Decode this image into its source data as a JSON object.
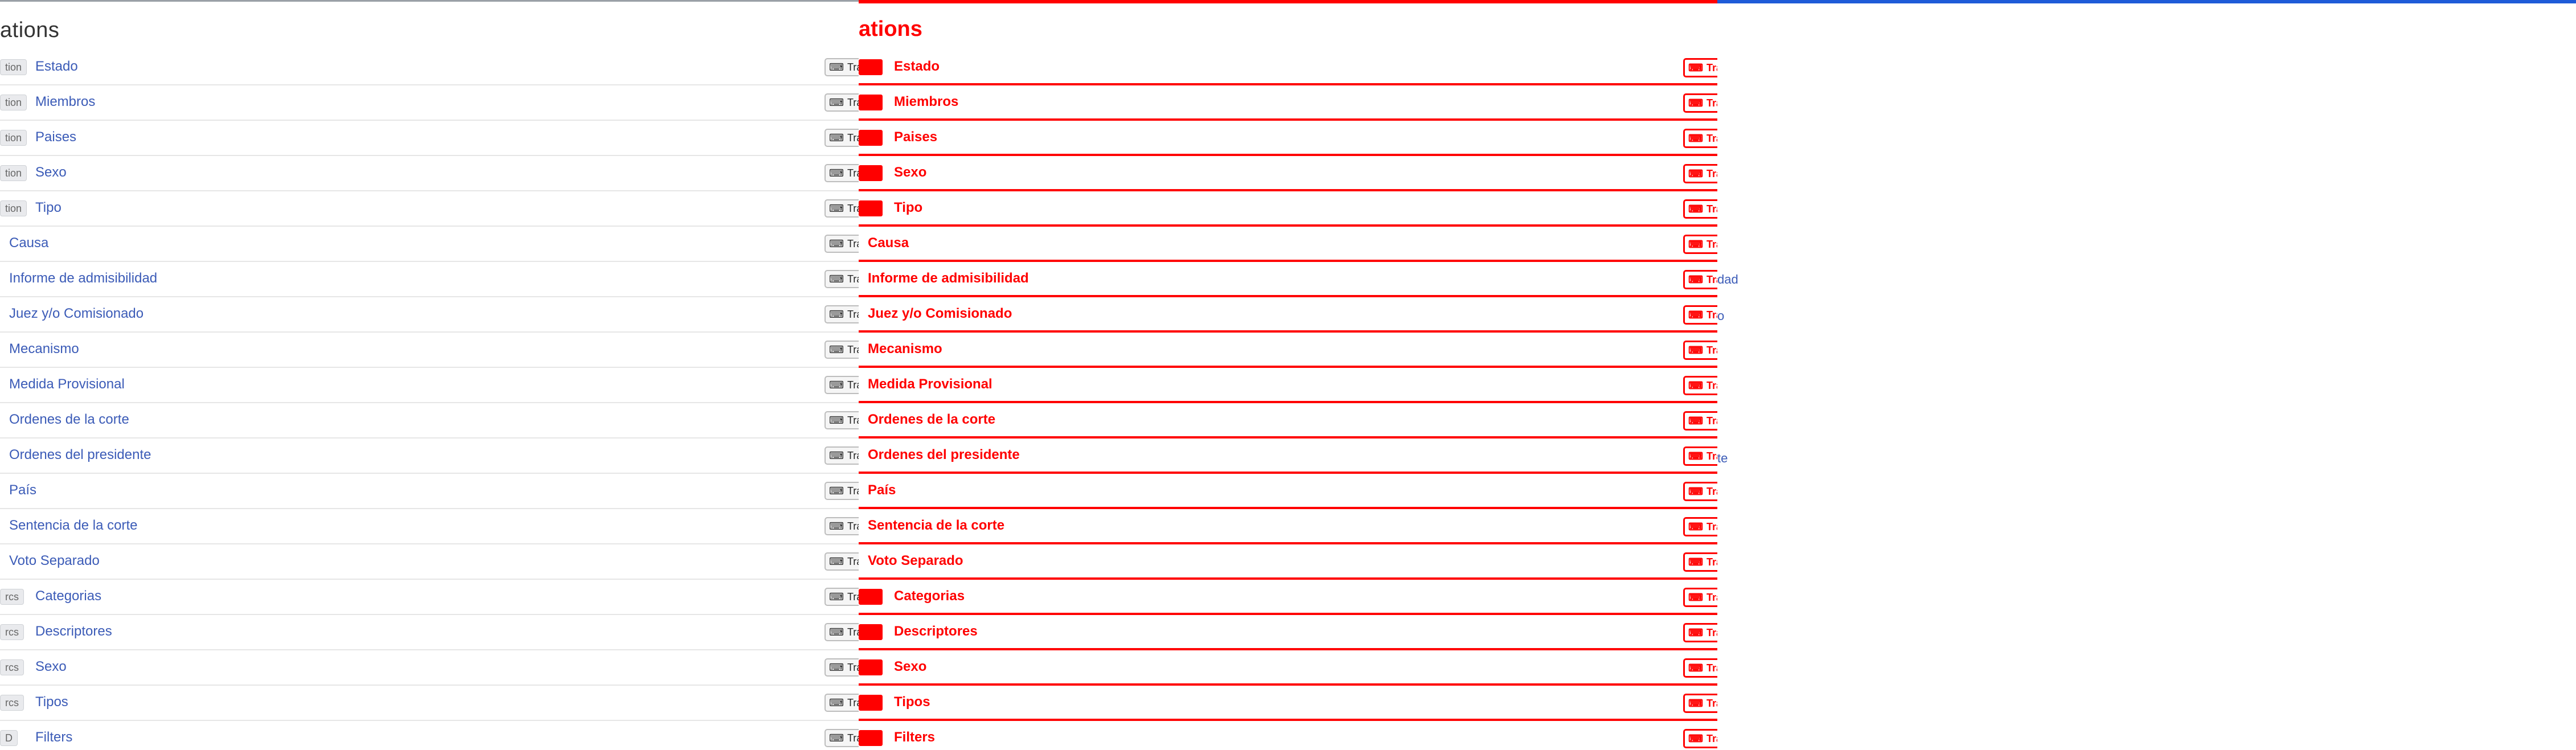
{
  "ui": {
    "title_suffix": "ations",
    "translate_label": "Tra",
    "translate_label_clipped": "Tra"
  },
  "rows": [
    {
      "badge": "tion",
      "label": "Estado"
    },
    {
      "badge": "tion",
      "label": "Miembros"
    },
    {
      "badge": "tion",
      "label": "Paises"
    },
    {
      "badge": "tion",
      "label": "Sexo"
    },
    {
      "badge": "tion",
      "label": "Tipo"
    },
    {
      "badge": "",
      "label": "Causa"
    },
    {
      "badge": "",
      "label": "Informe de admisibilidad"
    },
    {
      "badge": "",
      "label": "Juez y/o Comisionado"
    },
    {
      "badge": "",
      "label": "Mecanismo"
    },
    {
      "badge": "",
      "label": "Medida Provisional"
    },
    {
      "badge": "",
      "label": "Ordenes de la corte"
    },
    {
      "badge": "",
      "label": "Ordenes del presidente"
    },
    {
      "badge": "",
      "label": "País"
    },
    {
      "badge": "",
      "label": "Sentencia de la corte"
    },
    {
      "badge": "",
      "label": "Voto Separado"
    },
    {
      "badge": "rcs",
      "label": "Categorias"
    },
    {
      "badge": "rcs",
      "label": "Descriptores"
    },
    {
      "badge": "rcs",
      "label": "Sexo"
    },
    {
      "badge": "rcs",
      "label": "Tipos"
    },
    {
      "badge": "D",
      "label": "Filters"
    }
  ],
  "right_fragments": {
    "frag1": "dad",
    "frag2": "o",
    "frag3": "te"
  }
}
